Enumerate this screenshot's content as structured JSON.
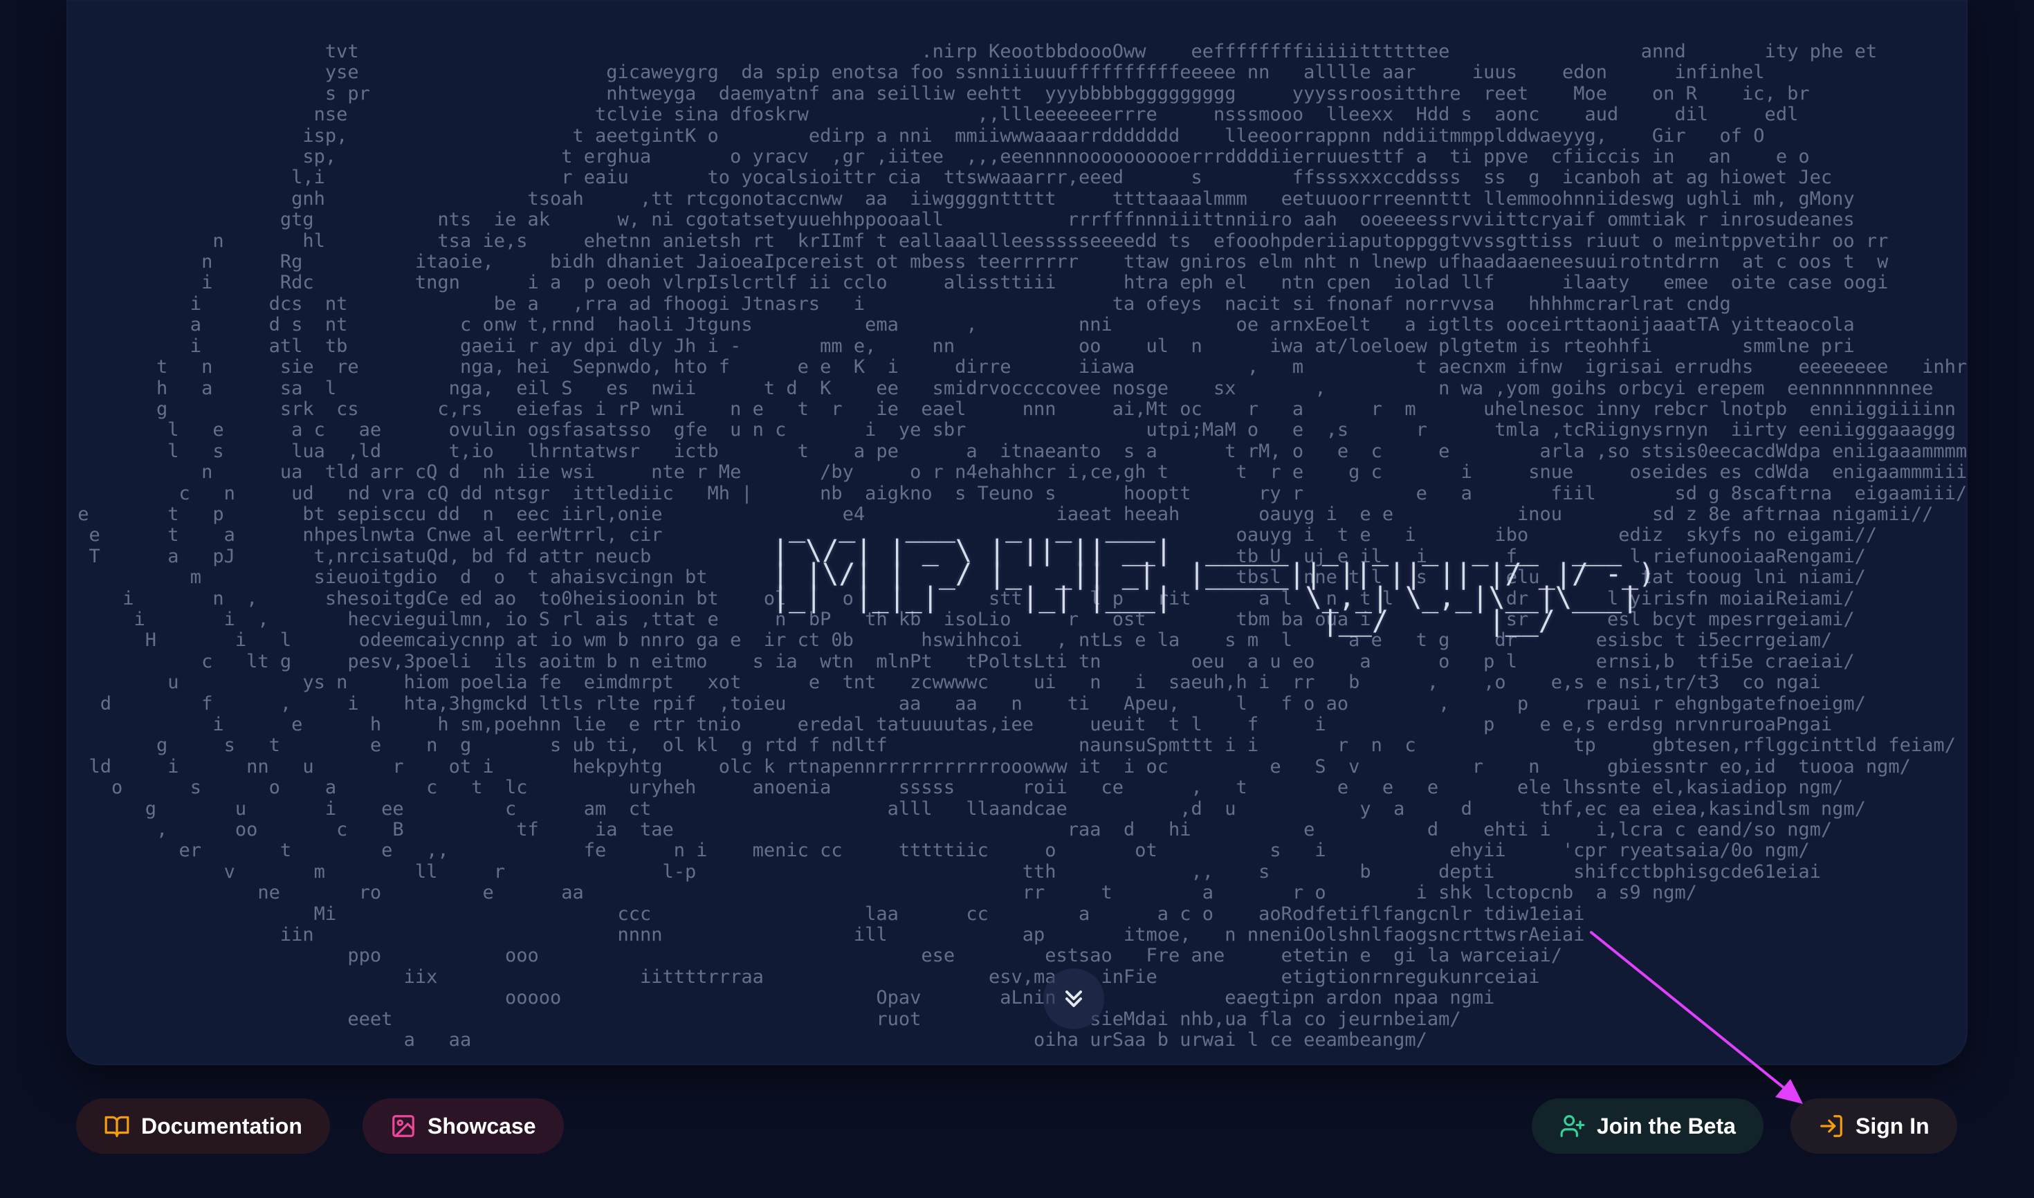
{
  "hero": {
    "ascii_text": "                       tvt                                                  .nirp KeootbbdoooOww    eeffffffffiiiiittttttee                 annd       ity phe et\n                       yse                      gicaweygrg  da spip enotsa foo ssnniiiuuuffffffffffeeeee nn   alllle aar     iuus    edon      infinhel\n                       s pr                     nhtweyga  daemyatnf ana seilliw eehtt  yyybbbbbggggggggg     yyyssroositthre  reet    Moe    on R    ic, br\n                      nse                      tclvie sina dfoskrw               ,,llleeeeeeerrre     nsssmooo  lleexx  Hdd s  aonc    aud     dil     edl\n                     isp,                    t aeetgintK o        edirp a nni  mmiiwwwaaaarrddddddd    lleeoorrappnn nddiitmmpplddwaeyyg,    Gir   of O\n                     sp,                    t erghua       o yracv  ,gr ,iitee  ,,,eeennnnoooooooooerrrddddiierruuesttf a  ti ppve  cfiiccis in   an    e o\n                    l,i                     r eaiu       to yocalsioittr cia  ttswwaaarrr,eeed      s        ffsssxxxccddsss  ss  g  icanboh at ag hiowet Jec\n                    gnh                  tsoah     ,tt rtcgonotaccnww  aa  iiwggggnttttt     ttttaaaalmmm   eetuuoorrreennttt llemmoohnniideswg ughli mh, gMony\n                   gtg           nts  ie ak      w, ni cgotatsetyuuehhppooaall           rrrfffnnniiittnniiro aah  ooeeeessrvviittcryaif ommtiak r inrosudeanes\n             n       hl          tsa ie,s     ehetnn anietsh rt  krIImf t eallaaallleessssseeeedd ts  efooohpderiiaputoppggtvvssgttiss riuut o meintppvetihr oo rr\n            n      Rg          itaoie,     bidh dhaniet JaioeaIpcereist ot mbess teerrrrrr    ttaw gniros elm nht n lnewp ufhaadaaeneesuuirotntdrrn  at c oos t  w\n            i      Rdc         tngn      i a  p oeoh vlrpIslcrtlf ii cclo     alissttiii      htra eph el   ntn cpen  iolad llf      ilaaty   emee  oite case oogi\n           i      dcs  nt             be a   ,rra ad fhoogi Jtnasrs   i                      ta ofeys  nacit si fnonaf norrvvsa   hhhhmcrarlrat cndg\n           a      d s  nt          c onw t,rnnd  haoli Jtguns          ema      ,         nni           oe arnxEoelt   a igtlts ooceirttaonijaaatTA yitteaocola\n           i      atl  tb          gaeii r ay dpi dly Jh i -       mm e,     nn           oo    ul  n      iwa at/loeloew plgtetm is rteohhfi        smmlne pri\n        t   n      sie  re         nga, hei  Sepnwdo, hto f      e e  K  i     dirre      iiawa          ,   m          t aecnxm ifnw  igrisai errudhs    eeeeeeee   inhr\n        h   a      sa  l          nga,  eil S   es  nwii      t d  K    ee   smidrvoccccovee nosge    sx       ,          n wa ,yom goihs orbcyi erepem  eennnnnnnnnee\n        g          srk  cs       c,rs   eiefas i rP wni    n e   t  r   ie  eael     nnn     ai,Mt oc    r   a      r  m      uhelnesoc inny rebcr lnotpb  enniiggiiiinn\n         l   e      a c   ae      ovulin ogsfasatsso  gfe  u n c       i  ye sbr                utpi;MaM o   e  ,s      r      tmla ,tcRiignysrnyn  iirty eeniigggaaaggg\n         l   s      lua  ,ld      t,io   lhrntatwsr   ictb       t    a pe      a  itnaeanto  s a      t rM, o   e  c     e        arla ,so stsis0eecacdWdpa eniigaaammmma\n            n      ua  tld arr cQ d  nh iie wsi     nte r Me       /by     o r n4ehahhcr i,ce,gh t      t  r e    g c       i     snue     oseides es cdWda  enigaammmiii\n          c   n     ud   nd vra cQ dd ntsgr  ittlediic   Mh |      nb  aigkno  s Teuno s      hooptt      ry r          e   a       fiil       sd g 8scaftrna  eigaamiii/\n e       t   p       bt sepisccu dd  n  eec iirl,onie                e4                 iaeat heeah       oauyg i  e e           inou        sd z 8e aftrnaa nigamii//\n  e      t    a      nhpeslnwta Cnwe al eerWtrrl, cir                                                   oauyg i  t e   i       ibo        ediz  skyfs no eigami//\n  T      a   pJ       t,nrcisatuQd, bd fd attr neucb                                                    tb U  uj e il   i       f          l riefunooiaaRengami/\n           m          sieuoitgdio  d  o  t ahaisvcingn bt                                               tbsl  nne t l   s       elu         tat tooug lni niami/\n     i       n  ,      shesoitgdCe ed ao  to0heisioonin bt    ol     o            stt      l p   rit      a l   n  t l          dr       l yirisfn moiaiReiami/\n      i       i  ,       hecvieguilmn, io S rl ais ,ttat e     n  bP   th kb  isoLio     r   ost        tbm ba oua i            sr       esl bcyt mpesrrgeiami/\n       H       i   l      odeemcaiycnnp at io wm b nnro ga e  ir ct 0b      hswihhcoi   , ntLs e la    s m  l     a e   t g    dr       esisbc t i5ecrrgeiam/\n            c   lt g     pesv,3poeli  ils aoitm b n eitmo    s ia  wtn  mlnPt   tPoltsLti tn        oeu  a u eo    a      o   p l       ernsi,b  tfi5e craeiai/\n         u           ys n     hiom poelia fe  eimdmrpt   xot      e  tnt   zcwwwwc    ui   n   i  saeuh,h i  rr   b      ,    ,o    e,s e nsi,tr/t3  co ngai\n   d        f      ,     i    hta,3hgmckd ltls rlte rpif  ,toieu          aa   aa   n    ti   Apeu,     l   f o ao        ,      p     rpaui r ehgnbgatefnoeigm/\n             i      e      h     h sm,poehnn lie  e rtr tnio     eredal tatuuuutas,iee     ueuit  t l    f     i              p    e e,s erdsg nrvnruroaPngai\n        g     s   t        e    n  g       s ub ti,  ol kl  g rtd f ndltf                 naunsuSpmttt i i       r  n  c              tp     gbtesen,rflggcinttld feiam/\n  ld     i      nn   u       r    ot i       hekpyhtg     olc k rtnapennrrrrrrrrrrrooowww it  i oc         e   S  v          r    n      gbiessntr eo,id  tuooa ngm/\n    o      s      o    a        c   t  lc         uryheh     anoenia      sssss      roii   ce      ,   t        e   e   e       ele lhssnte el,kasiadiop ngm/\n       g       u       i    ee         c      am  ct                     alll   llaandcae          ,d  u           y  a     d      thf,ec ea eiea,kasindlsm ngm/\n        ,      oo       c    B          tf     ia  tae                                   raa  d   hi          e          d    ehti i    i,lcra c eand/so ngm/\n          er       t        e   ,,            fe      n i    menic cc     tttttiic     o       ot          s   i           ehyii     'cpr ryeatsaia/0o ngm/\n              v       m        ll     r              l-p                             tth            ,,    s        b      depti       shifcctbphisgcde61eiai\n                 ne       ro         e      aa                                       rr     t        a       r o        i shk lctopcnb  a s9 ngm/\n                      Mi                         ccc                   laa      cc        a      a c o    aoRodfetiflfangcnlr tdiw1eiai\n                   iin                           nnnn                 ill            ap       itmoe,   n nneniOolshnlfaogsncrttwsrAeiai\n                         ppo           ooo                                  ese        estsao   Fre ane     etetin e  gi la warceiai/\n                              iix                  iittttrrraa                    esv,ma    inFie           etigtionrnregukunrceiai\n                                       ooooo                            Opav       aLnin               eaegtipn ardon npaa ngmi\n                         eeet                                           ruot               sieMdai nhb,ua fla co jeurnbeiam/\n                              a   aa                                                  oiha urSaa b urwai l ce eeambeangm/",
    "logo_ascii": " _  _   ___   _  _  ___\n| \\/ | | _ \\ | || || __|  _____  _  _  _  _ __  ___\n| |\\/| |  _/ |_  _|| _|  |_____|| || || || |/ _|/ -_)\n|_|  |_|_|     |_| |___|        \\_,_| \\_,_|\\__|\\___|\n                                 |__/      |__/"
  },
  "actions": {
    "documentation_label": "Documentation",
    "showcase_label": "Showcase",
    "join_beta_label": "Join the Beta",
    "sign_in_label": "Sign In"
  },
  "icons": {
    "documentation": "book-open-icon",
    "showcase": "image-icon",
    "join_beta": "user-plus-icon",
    "sign_in": "log-in-icon",
    "scroll": "chevrons-down-icon"
  },
  "colors": {
    "background": "#0b0f24",
    "panel": "#111a35",
    "ascii_text": "#6c7794",
    "documentation_icon": "#f59e0b",
    "showcase_icon": "#ec4899",
    "join_beta_icon": "#34d399",
    "sign_in_icon": "#f59e0b",
    "annotation_arrow": "#e040fb"
  }
}
